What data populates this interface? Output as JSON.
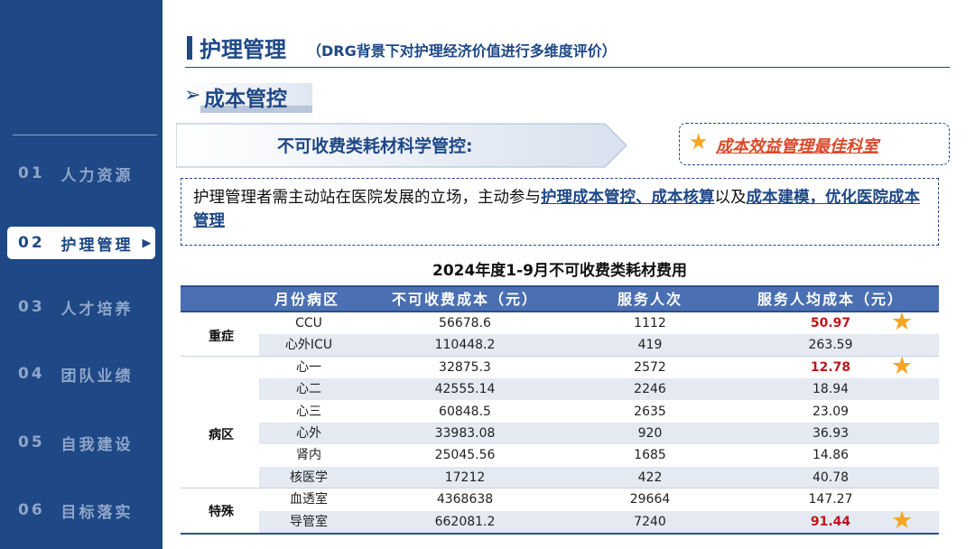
{
  "sidebar": {
    "items": [
      {
        "num": "01",
        "label": "人力资源",
        "active": false
      },
      {
        "num": "02",
        "label": "护理管理",
        "active": true
      },
      {
        "num": "03",
        "label": "人才培养",
        "active": false
      },
      {
        "num": "04",
        "label": "团队业绩",
        "active": false
      },
      {
        "num": "05",
        "label": "自我建设",
        "active": false
      },
      {
        "num": "06",
        "label": "目标落实",
        "active": false
      }
    ],
    "active_arrow": "▶"
  },
  "header": {
    "title": "护理管理",
    "subtitle": "（DRG背景下对护理经济价值进行多维度评价）"
  },
  "section": {
    "arrow": "➢",
    "title": "成本管控"
  },
  "banner": {
    "label": "不可收费类耗材科学管控:"
  },
  "badge": {
    "star": "★",
    "text": "成本效益管理最佳科室"
  },
  "description": {
    "part1": "护理管理者需主动站在医院发展的立场，主动参与",
    "hl1": "护理成本管控、成本核算",
    "part2": "以及",
    "hl2": "成本建模，优化医院成本管理"
  },
  "table": {
    "title": "2024年度1-9月不可收费类耗材费用",
    "headers": [
      "月份病区",
      "不可收费成本（元）",
      "服务人次",
      "服务人均成本（元）"
    ],
    "groups": [
      {
        "label": "重症"
      },
      {
        "label": "病区"
      },
      {
        "label": "特殊"
      }
    ],
    "rows": [
      {
        "unit": "CCU",
        "cost": "56678.6",
        "visits": "1112",
        "avg": "50.97",
        "highlight": true
      },
      {
        "unit": "心外ICU",
        "cost": "110448.2",
        "visits": "419",
        "avg": "263.59",
        "highlight": false
      },
      {
        "unit": "心一",
        "cost": "32875.3",
        "visits": "2572",
        "avg": "12.78",
        "highlight": true
      },
      {
        "unit": "心二",
        "cost": "42555.14",
        "visits": "2246",
        "avg": "18.94",
        "highlight": false
      },
      {
        "unit": "心三",
        "cost": "60848.5",
        "visits": "2635",
        "avg": "23.09",
        "highlight": false
      },
      {
        "unit": "心外",
        "cost": "33983.08",
        "visits": "920",
        "avg": "36.93",
        "highlight": false
      },
      {
        "unit": "肾内",
        "cost": "25045.56",
        "visits": "1685",
        "avg": "14.86",
        "highlight": false
      },
      {
        "unit": "核医学",
        "cost": "17212",
        "visits": "422",
        "avg": "40.78",
        "highlight": false
      },
      {
        "unit": "血透室",
        "cost": "4368638",
        "visits": "29664",
        "avg": "147.27",
        "highlight": false
      },
      {
        "unit": "导管室",
        "cost": "662081.2",
        "visits": "7240",
        "avg": "91.44",
        "highlight": true
      }
    ],
    "star_glyph": "★"
  },
  "colors": {
    "brand": "#1e4886",
    "header_bg": "#4a6fb3",
    "highlight_red": "#c0161c",
    "star": "#f5a623",
    "badge_text": "#d94a2b"
  }
}
